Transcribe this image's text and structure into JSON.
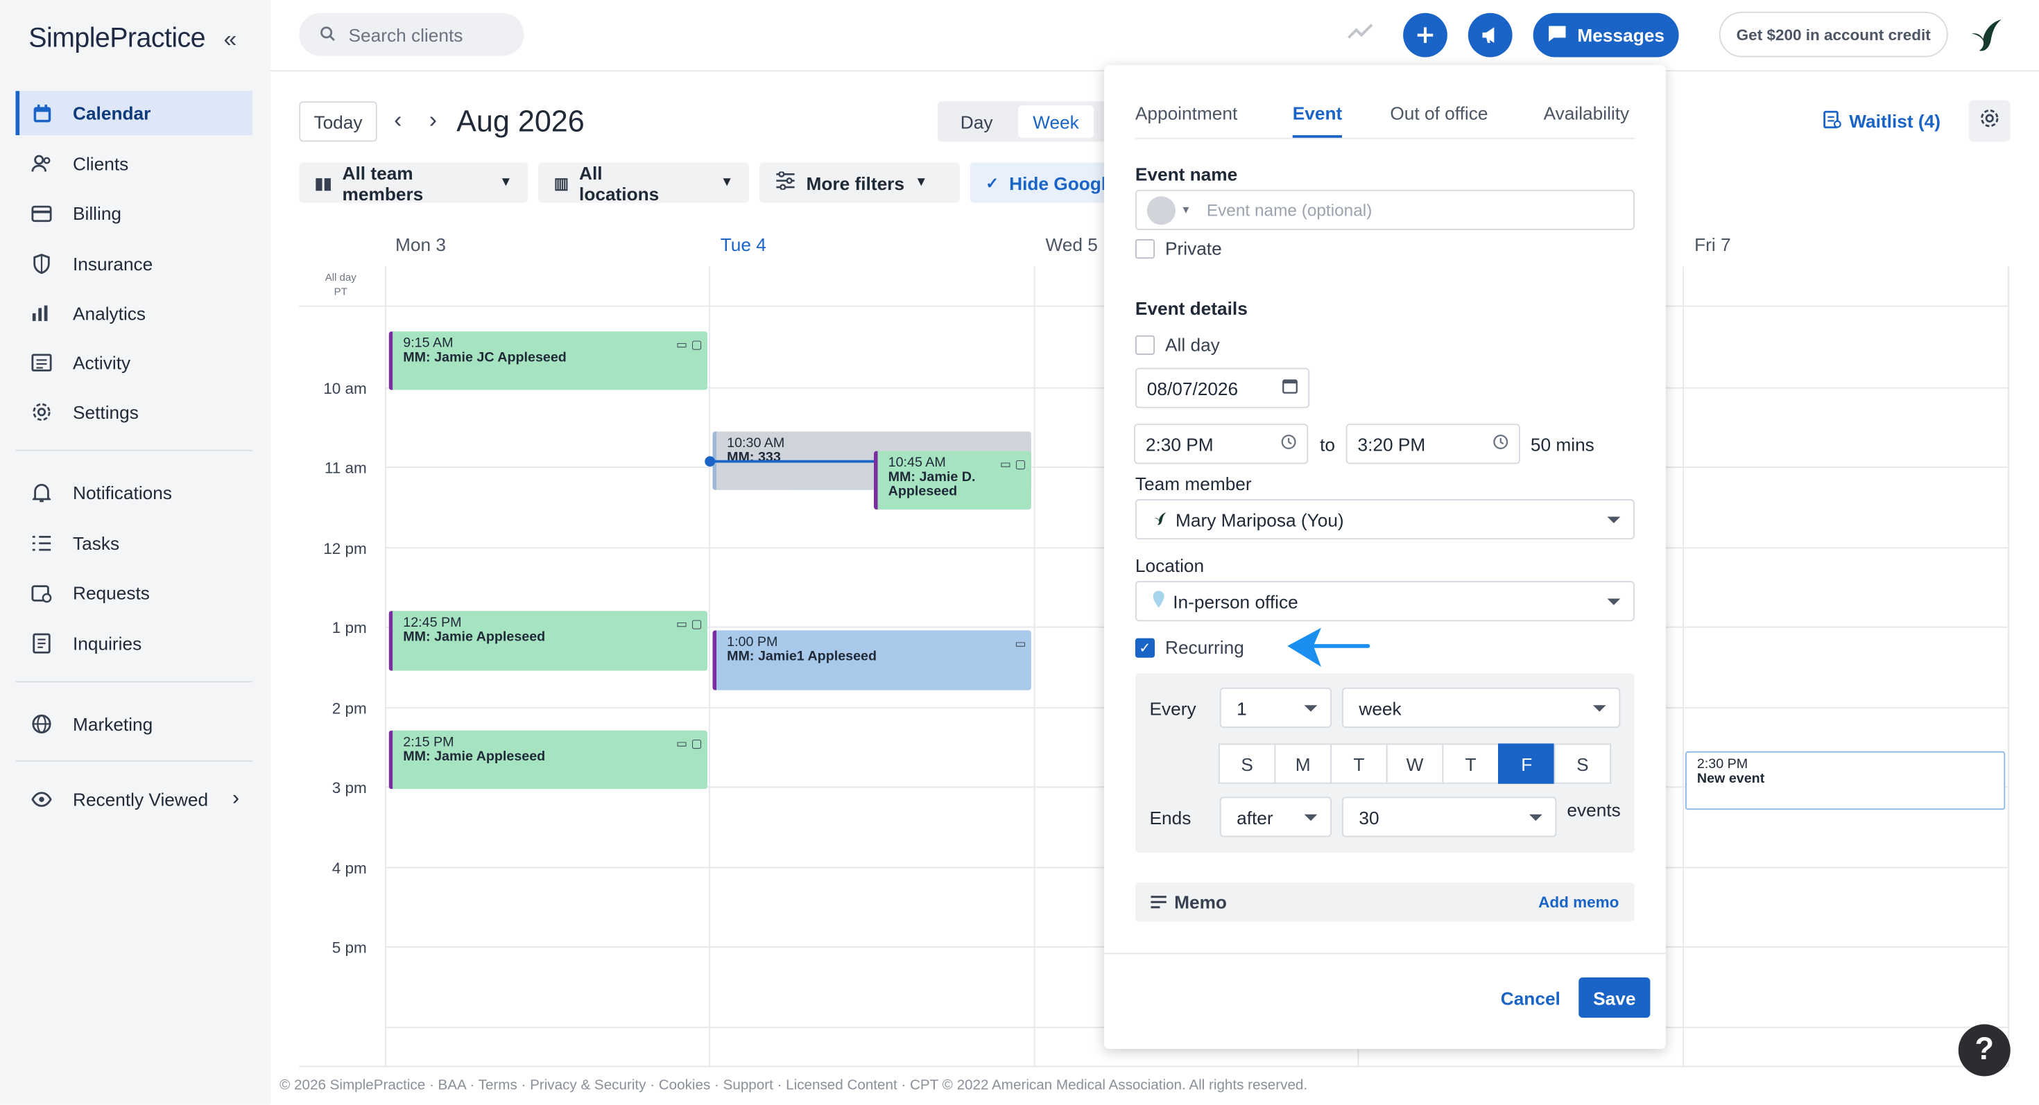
{
  "app": {
    "logo": "SimplePractice"
  },
  "sidebar": {
    "items": [
      {
        "label": "Calendar",
        "icon": "calendar-icon"
      },
      {
        "label": "Clients",
        "icon": "clients-icon"
      },
      {
        "label": "Billing",
        "icon": "billing-icon"
      },
      {
        "label": "Insurance",
        "icon": "shield-icon"
      },
      {
        "label": "Analytics",
        "icon": "analytics-icon"
      },
      {
        "label": "Activity",
        "icon": "activity-icon"
      },
      {
        "label": "Settings",
        "icon": "gear-icon"
      },
      {
        "label": "Notifications",
        "icon": "bell-icon"
      },
      {
        "label": "Tasks",
        "icon": "tasks-icon"
      },
      {
        "label": "Requests",
        "icon": "requests-icon"
      },
      {
        "label": "Inquiries",
        "icon": "inquiries-icon"
      },
      {
        "label": "Marketing",
        "icon": "globe-icon"
      },
      {
        "label": "Recently Viewed",
        "icon": "eye-icon"
      }
    ]
  },
  "topbar": {
    "search_placeholder": "Search clients",
    "messages_label": "Messages",
    "credit_label": "Get $200 in account credit"
  },
  "calendar": {
    "today_label": "Today",
    "month_label": "Aug 2026",
    "view_day": "Day",
    "view_week": "Week",
    "filters": {
      "team": "All team members",
      "locations": "All locations",
      "more": "More filters",
      "hide_google": "Hide Google"
    },
    "waitlist_label": "Waitlist (4)",
    "days": [
      "Mon 3",
      "Tue 4",
      "Wed 5",
      "Fri 7"
    ],
    "allday_label": "All day",
    "tz_label": "PT",
    "hours": [
      "10 am",
      "11 am",
      "12 pm",
      "1 pm",
      "2 pm",
      "3 pm",
      "4 pm",
      "5 pm"
    ],
    "appointments": [
      {
        "time": "9:15 AM",
        "name": "MM: Jamie JC Appleseed"
      },
      {
        "time": "12:45 PM",
        "name": "MM: Jamie Appleseed"
      },
      {
        "time": "2:15 PM",
        "name": "MM: Jamie Appleseed"
      },
      {
        "time": "10:30 AM",
        "name": "MM: 333"
      },
      {
        "time": "10:45 AM",
        "name": "MM: Jamie D. Appleseed"
      },
      {
        "time": "1:00 PM",
        "name": "MM: Jamie1 Appleseed"
      },
      {
        "time": "2:30 PM",
        "name": "New event"
      }
    ]
  },
  "modal": {
    "tabs": [
      "Appointment",
      "Event",
      "Out of office",
      "Availability"
    ],
    "event_name_label": "Event name",
    "event_name_placeholder": "Event name (optional)",
    "private_label": "Private",
    "event_details_label": "Event details",
    "all_day_label": "All day",
    "date": "08/07/2026",
    "start_time": "2:30 PM",
    "to_label": "to",
    "end_time": "3:20 PM",
    "duration": "50 mins",
    "team_member_label": "Team member",
    "team_member": "Mary Mariposa (You)",
    "location_label": "Location",
    "location": "In-person office",
    "recurring_label": "Recurring",
    "every_label": "Every",
    "every_value": "1",
    "every_unit": "week",
    "weekdays": [
      "S",
      "M",
      "T",
      "W",
      "T",
      "F",
      "S"
    ],
    "ends_label": "Ends",
    "ends_value": "after",
    "ends_count": "30",
    "events_label": "events",
    "memo_label": "Memo",
    "add_memo": "Add memo",
    "cancel": "Cancel",
    "save": "Save"
  },
  "footer": "© 2026 SimplePractice · BAA · Terms · Privacy & Security · Cookies · Support · Licensed Content · CPT © 2022 American Medical Association. All rights reserved.",
  "colors": {
    "accent": "#1a63c7",
    "appt_green": "#a6e3c0",
    "appt_blue": "#a9c9ea",
    "sidebar_bg": "#f4f5f7"
  }
}
